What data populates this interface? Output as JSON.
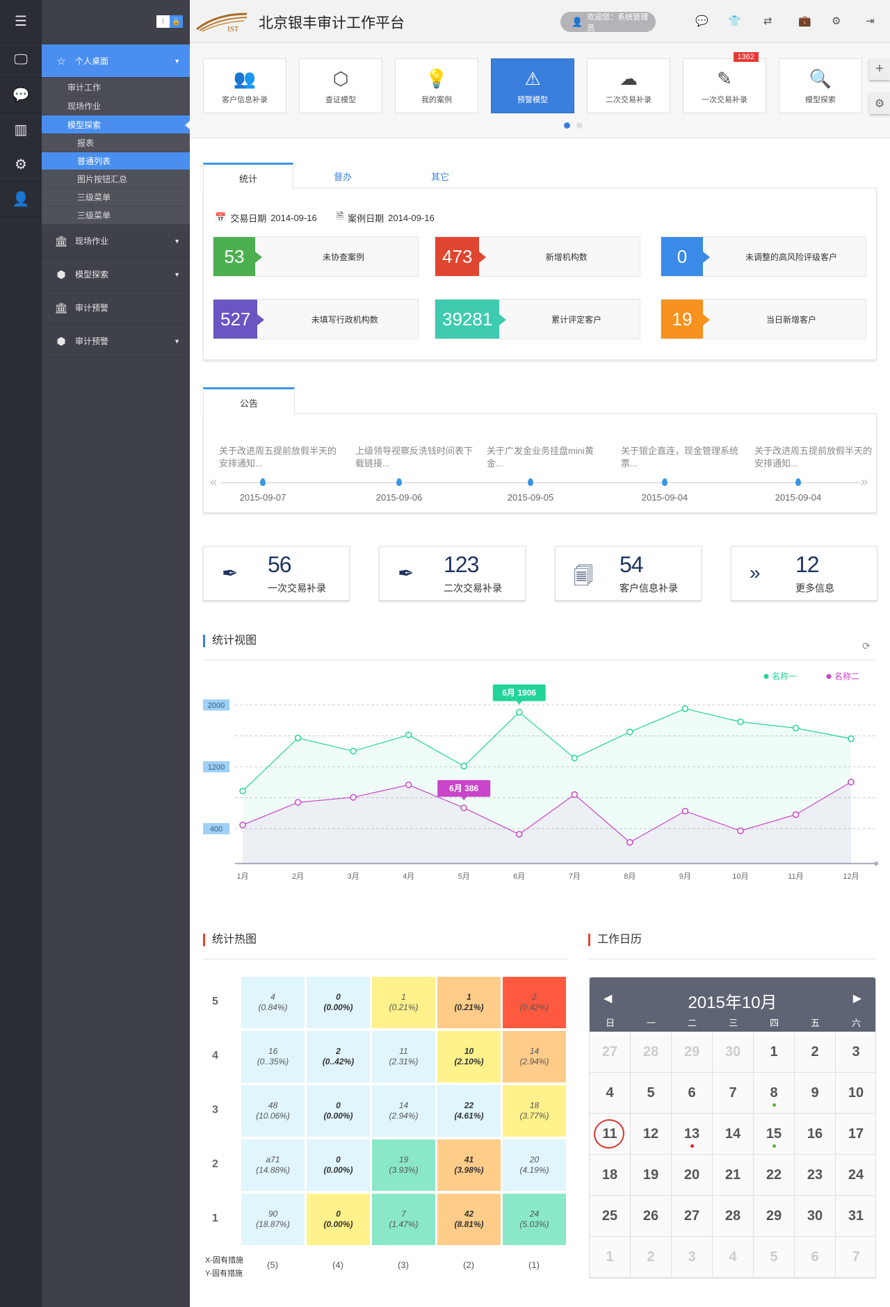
{
  "app": {
    "title": "北京银丰审计工作平台",
    "logo_text": "IST",
    "welcome": "欢迎您：系统管理员"
  },
  "header_icons": [
    "chat-icon",
    "shirt-icon",
    "swap-icon",
    "briefcase-icon",
    "gear-icon",
    "logout-icon"
  ],
  "sidebar": {
    "icon_strip": [
      "menu-icon",
      "monitor-icon",
      "chat-settings-icon",
      "binders-icon",
      "gear-icon",
      "user-settings-icon"
    ],
    "items": [
      {
        "label": "个人桌面",
        "level": 1,
        "active": true,
        "icon": "star-icon",
        "caret": true
      },
      {
        "label": "审计工作",
        "level": 2
      },
      {
        "label": "现场作业",
        "level": 2
      },
      {
        "label": "模型探索",
        "level": 2,
        "active": true
      },
      {
        "label": "报表",
        "level": 3
      },
      {
        "label": "普通列表",
        "level": 3,
        "active": true
      },
      {
        "label": "图片按钮汇总",
        "level": 3
      },
      {
        "label": "三级菜单",
        "level": 3
      },
      {
        "label": "三级菜单",
        "level": 3
      },
      {
        "label": "现场作业",
        "level": 1,
        "icon": "bank-icon",
        "caret": true
      },
      {
        "label": "模型探索",
        "level": 1,
        "icon": "cube-icon",
        "caret": true
      },
      {
        "label": "审计预警",
        "level": 1,
        "icon": "bank-icon"
      },
      {
        "label": "审计预警",
        "level": 1,
        "icon": "cube-icon",
        "caret": true
      }
    ]
  },
  "tiles": [
    {
      "label": "客户信息补录",
      "icon": "users-icon"
    },
    {
      "label": "查证模型",
      "icon": "box-icon"
    },
    {
      "label": "我的案例",
      "icon": "lightbulb-icon"
    },
    {
      "label": "预警模型",
      "icon": "warning-icon",
      "active": true
    },
    {
      "label": "二次交易补录",
      "icon": "cloud-refresh-icon"
    },
    {
      "label": "一次交易补录",
      "icon": "edit-icon",
      "badge": "1362"
    },
    {
      "label": "模型探索",
      "icon": "search-icon"
    }
  ],
  "carousel": {
    "pages": 2,
    "current": 1
  },
  "stats": {
    "tabs": [
      "统计",
      "督办",
      "其它"
    ],
    "trade_date_label": "交易日期",
    "trade_date": "2014-09-16",
    "case_date_label": "案例日期",
    "case_date": "2014-09-16",
    "cards": [
      {
        "value": "53",
        "label": "未协查案例",
        "color": "#4cb050"
      },
      {
        "value": "473",
        "label": "新增机构数",
        "color": "#e0452f"
      },
      {
        "value": "0",
        "label": "未调整的高风险评级客户",
        "color": "#3a8ae8"
      },
      {
        "value": "527",
        "label": "未填写行政机构数",
        "color": "#6a55c2"
      },
      {
        "value": "39281",
        "label": "累计评定客户",
        "color": "#3ecbb0"
      },
      {
        "value": "19",
        "label": "当日新增客户",
        "color": "#f7921e"
      }
    ]
  },
  "notices": {
    "tab": "公告",
    "items": [
      {
        "text": "关于改进周五提前放假半天的安排通知...",
        "date": "2015-09-07"
      },
      {
        "text": "上级领导视察反洗钱时间表下载链接...",
        "date": "2015-09-06"
      },
      {
        "text": "关于广发金业务挂盘mini黄金...",
        "date": "2015-09-05"
      },
      {
        "text": "关于银企直连，现金管理系统票...",
        "date": "2015-09-04"
      },
      {
        "text": "关于改进周五提前放假半天的安排通知...",
        "date": "2015-09-04"
      }
    ]
  },
  "info_cards": [
    {
      "value": "56",
      "label": "一次交易补录",
      "icon": "feather-icon"
    },
    {
      "value": "123",
      "label": "二次交易补录",
      "icon": "feather-icon"
    },
    {
      "value": "54",
      "label": "客户信息补录",
      "icon": "document-icon"
    },
    {
      "value": "12",
      "label": "更多信息",
      "icon": "double-chevron-right-icon"
    }
  ],
  "chart_section": {
    "title": "统计视图"
  },
  "chart_data": [
    {
      "type": "line",
      "categories": [
        "1月",
        "2月",
        "3月",
        "4月",
        "5月",
        "6月",
        "7月",
        "8月",
        "9月",
        "10月",
        "11月",
        "12月"
      ],
      "series": [
        {
          "name": "名称一",
          "color": "#22d39a",
          "values": [
            887,
            1573,
            1403,
            1612,
            1209,
            1906,
            1313,
            1651,
            1952,
            1782,
            1701,
            1564
          ]
        },
        {
          "name": "名称二",
          "color": "#c944c9",
          "values": [
            448,
            740,
            806,
            967,
            669,
            328,
            842,
            224,
            627,
            373,
            582,
            1003
          ]
        }
      ],
      "yticks": [
        "2000",
        "1200",
        "400"
      ],
      "ylim": [
        -50,
        2300
      ],
      "grid": true,
      "legend": "top-right",
      "annotations": [
        {
          "series": 0,
          "index": 5,
          "text": "6月  1906"
        },
        {
          "series": 1,
          "index": 4,
          "text": "6月  386"
        }
      ]
    },
    {
      "type": "heatmap",
      "title": "统计热图",
      "xlabel": "X-固有措施",
      "ylabel": "Y-固有措施",
      "x_labels": [
        "(5)",
        "(4)",
        "(3)",
        "(2)",
        "(1)"
      ],
      "y_labels": [
        "5",
        "4",
        "3",
        "2",
        "1"
      ],
      "rows": [
        [
          {
            "v": "4",
            "p": "(0.84%)",
            "c": "#e0f5fc"
          },
          {
            "v": "0",
            "p": "(0.00%)",
            "c": "#e0f5fc",
            "b": 1
          },
          {
            "v": "1",
            "p": "(0.21%)",
            "c": "#fff18c"
          },
          {
            "v": "1",
            "p": "(0.21%)",
            "c": "#ffcc8a",
            "b": 1
          },
          {
            "v": "2",
            "p": "(0.42%)",
            "c": "#ff5a40"
          }
        ],
        [
          {
            "v": "16",
            "p": "(0..35%)",
            "c": "#e0f5fc"
          },
          {
            "v": "2",
            "p": "(0..42%)",
            "c": "#e0f5fc",
            "b": 1
          },
          {
            "v": "11",
            "p": "(2.31%)",
            "c": "#e0f5fc"
          },
          {
            "v": "10",
            "p": "(2.10%)",
            "c": "#fff18c",
            "b": 1
          },
          {
            "v": "14",
            "p": "(2.94%)",
            "c": "#ffcc8a"
          }
        ],
        [
          {
            "v": "48",
            "p": "(10.06%)",
            "c": "#e0f5fc"
          },
          {
            "v": "0",
            "p": "(0.00%)",
            "c": "#e0f5fc",
            "b": 1
          },
          {
            "v": "14",
            "p": "(2.94%)",
            "c": "#e0f5fc"
          },
          {
            "v": "22",
            "p": "(4.61%)",
            "c": "#e0f5fc",
            "b": 1
          },
          {
            "v": "18",
            "p": "(3.77%)",
            "c": "#fff18c"
          }
        ],
        [
          {
            "v": "a71",
            "p": "(14.88%)",
            "c": "#e0f5fc"
          },
          {
            "v": "0",
            "p": "(0.00%)",
            "c": "#e0f5fc",
            "b": 1
          },
          {
            "v": "19",
            "p": "(3.93%)",
            "c": "#8ae8c8"
          },
          {
            "v": "41",
            "p": "(3.98%)",
            "c": "#ffcc8a",
            "b": 1
          },
          {
            "v": "20",
            "p": "(4.19%)",
            "c": "#e0f5fc"
          }
        ],
        [
          {
            "v": "90",
            "p": "(18.87%)",
            "c": "#e0f5fc"
          },
          {
            "v": "0",
            "p": "(0.00%)",
            "c": "#fff18c",
            "b": 1
          },
          {
            "v": "7",
            "p": "(1.47%)",
            "c": "#8ae8c8"
          },
          {
            "v": "42",
            "p": "(8.81%)",
            "c": "#ffcc8a",
            "b": 1
          },
          {
            "v": "24",
            "p": "(5.03%)",
            "c": "#8ae8c8"
          }
        ]
      ]
    }
  ],
  "calendar": {
    "title": "工作日历",
    "month": "2015年10月",
    "weekdays": [
      "日",
      "一",
      "二",
      "三",
      "四",
      "五",
      "六"
    ],
    "today": "11",
    "weeks": [
      [
        {
          "d": "27",
          "o": 1
        },
        {
          "d": "28",
          "o": 1
        },
        {
          "d": "29",
          "o": 1
        },
        {
          "d": "30",
          "o": 1
        },
        {
          "d": "1"
        },
        {
          "d": "2"
        },
        {
          "d": "3"
        }
      ],
      [
        {
          "d": "4"
        },
        {
          "d": "5"
        },
        {
          "d": "6"
        },
        {
          "d": "7"
        },
        {
          "d": "8",
          "dot": "#5cb82e"
        },
        {
          "d": "9"
        },
        {
          "d": "10"
        }
      ],
      [
        {
          "d": "11"
        },
        {
          "d": "12"
        },
        {
          "d": "13",
          "dot": "#f01c1c"
        },
        {
          "d": "14"
        },
        {
          "d": "15",
          "dot": "#5cb82e"
        },
        {
          "d": "16"
        },
        {
          "d": "17"
        }
      ],
      [
        {
          "d": "18"
        },
        {
          "d": "19"
        },
        {
          "d": "20"
        },
        {
          "d": "21"
        },
        {
          "d": "22"
        },
        {
          "d": "23"
        },
        {
          "d": "24"
        }
      ],
      [
        {
          "d": "25"
        },
        {
          "d": "26"
        },
        {
          "d": "27"
        },
        {
          "d": "28"
        },
        {
          "d": "29"
        },
        {
          "d": "30"
        },
        {
          "d": "31"
        }
      ],
      [
        {
          "d": "1",
          "o": 1
        },
        {
          "d": "2",
          "o": 1
        },
        {
          "d": "3",
          "o": 1
        },
        {
          "d": "4",
          "o": 1
        },
        {
          "d": "5",
          "o": 1
        },
        {
          "d": "6",
          "o": 1
        },
        {
          "d": "7",
          "o": 1
        }
      ]
    ]
  }
}
